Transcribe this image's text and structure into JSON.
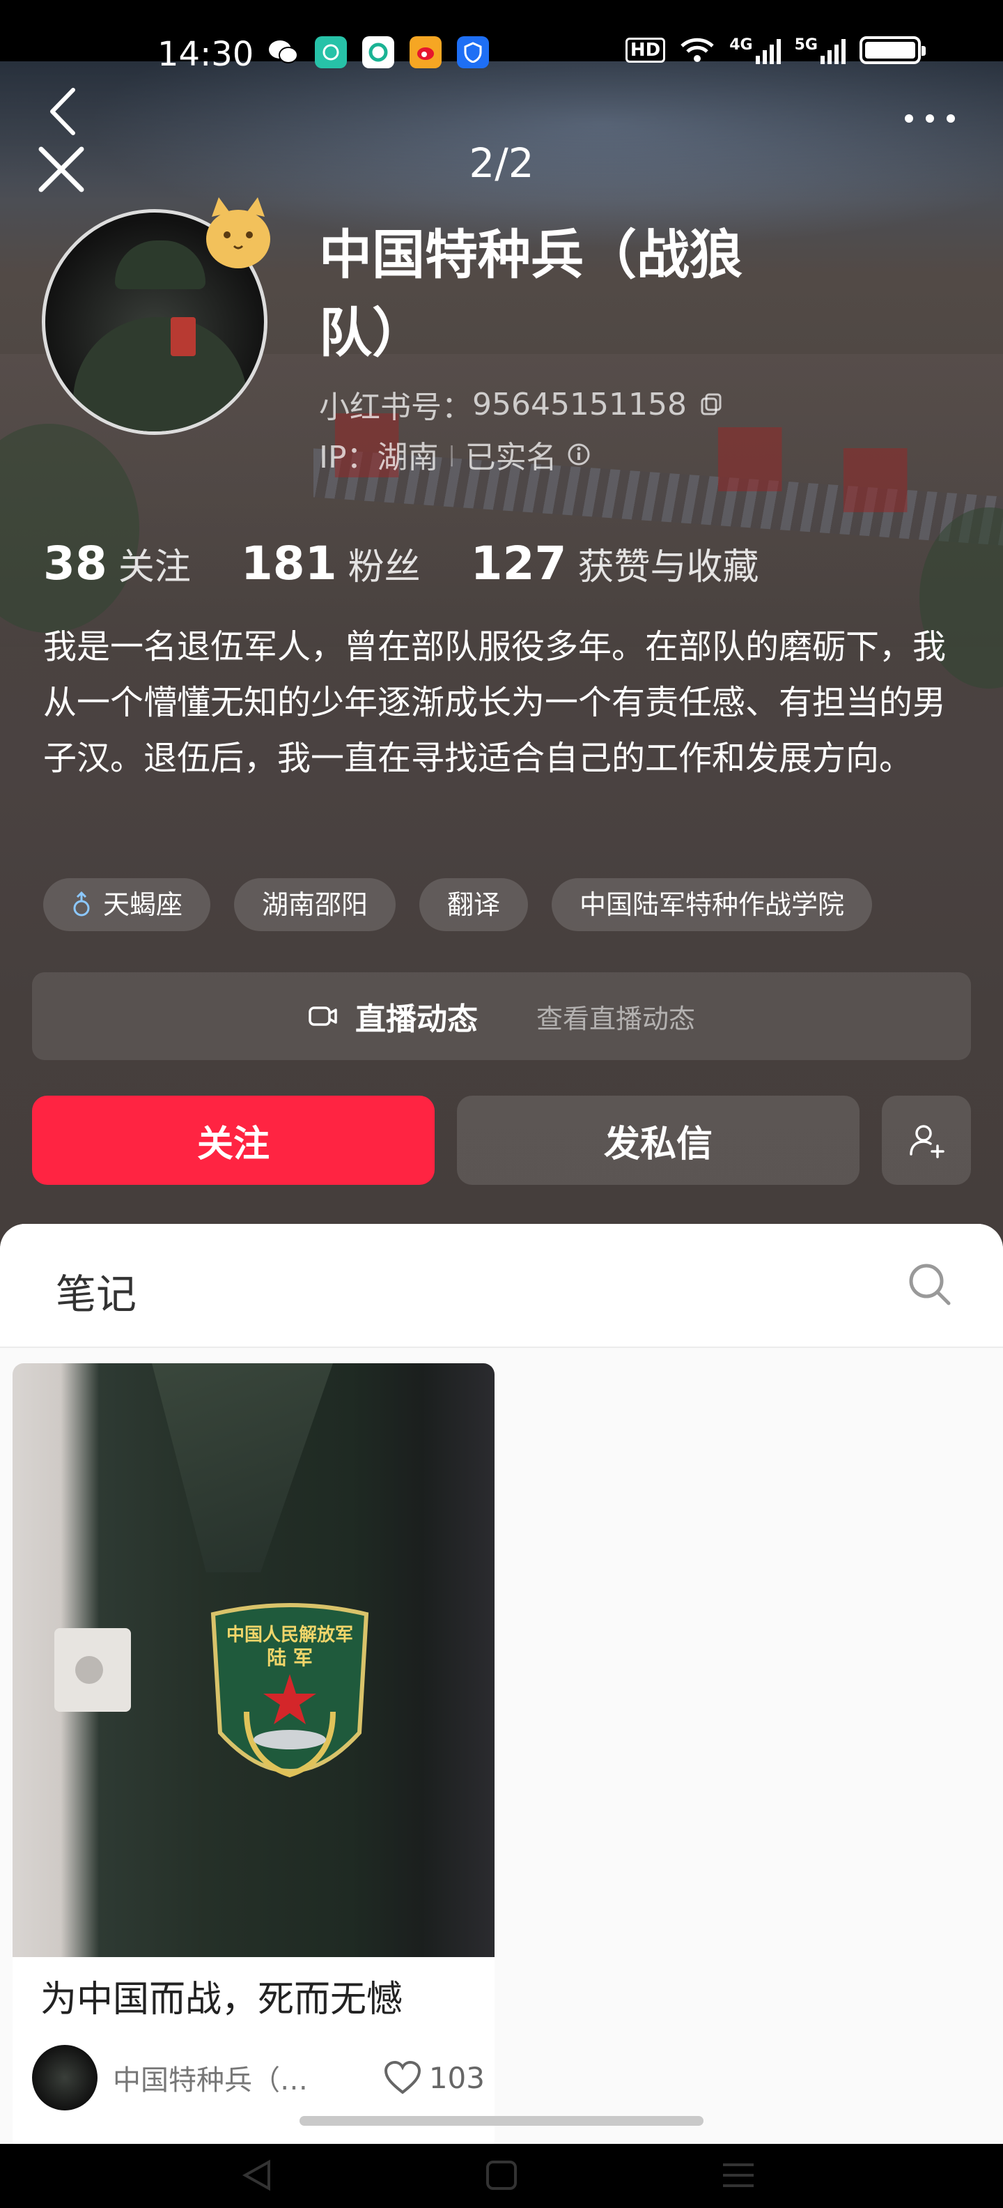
{
  "status_bar": {
    "time": "14:30",
    "apps": [
      "wechat-icon",
      "chat-app-icon",
      "browser-icon",
      "weibo-icon",
      "security-app-icon"
    ],
    "hd_label": "HD",
    "net1": "4G",
    "net2": "5G"
  },
  "header": {
    "page_counter": "2/2"
  },
  "profile": {
    "nickname": "中国特种兵（战狼队）",
    "id_label": "小红书号：",
    "id_value": "95645151158",
    "ip_label": "IP：湖南",
    "verified": "已实名",
    "stats": [
      {
        "value": "38",
        "label": "关注"
      },
      {
        "value": "181",
        "label": "粉丝"
      },
      {
        "value": "127",
        "label": "获赞与收藏"
      }
    ],
    "bio": "我是一名退伍军人，曾在部队服役多年。在部队的磨砺下，我从一个懵懂无知的少年逐渐成长为一个有责任感、有担当的男子汉。退伍后，我一直在寻找适合自己的工作和发展方向。",
    "tags": [
      "天蝎座",
      "湖南邵阳",
      "翻译",
      "中国陆军特种作战学院"
    ]
  },
  "live": {
    "title": "直播动态",
    "subtitle": "查看直播动态"
  },
  "actions": {
    "follow": "关注",
    "message": "发私信"
  },
  "notes_panel": {
    "tab_label": "笔记"
  },
  "note_card": {
    "title": "为中国而战，死而无憾",
    "author": "中国特种兵（…",
    "likes": "103",
    "patch_line1": "中国人民解放军",
    "patch_line2": "陆 军"
  },
  "colors": {
    "accent": "#ff2442",
    "panel_bg": "#fafafa"
  }
}
